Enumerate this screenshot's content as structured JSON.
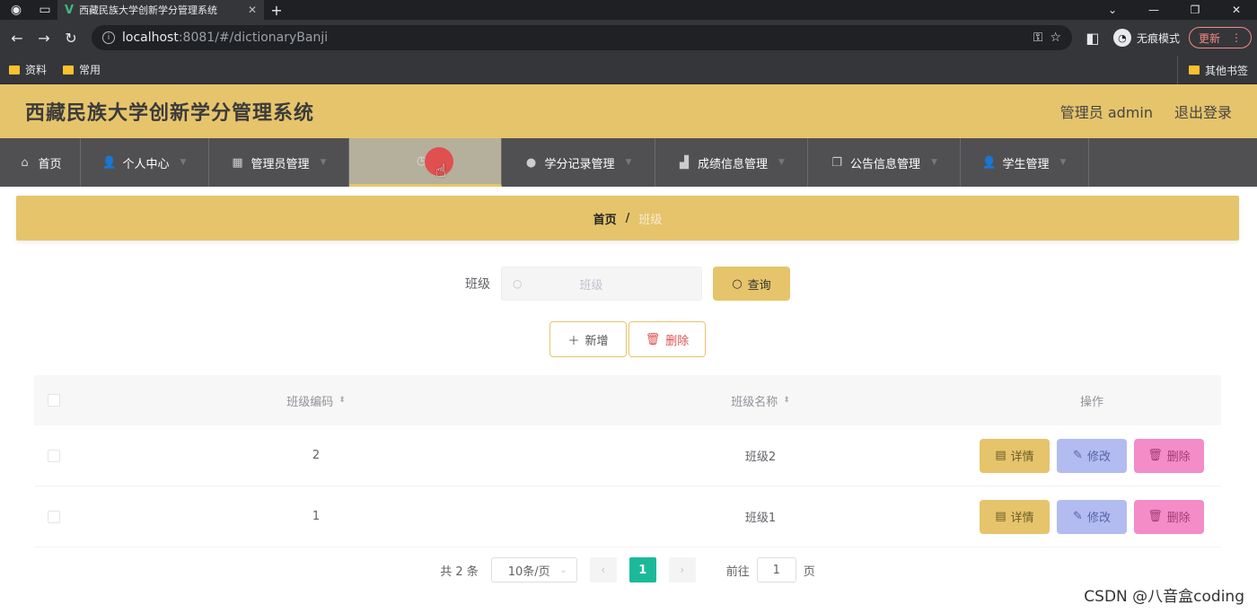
{
  "browser": {
    "tab_title": "西藏民族大学创新学分管理系统",
    "url_host": "localhost",
    "url_rest": ":8081/#/dictionaryBanji",
    "incognito_label": "无痕模式",
    "update_label": "更新",
    "bookmarks": [
      "资料",
      "常用"
    ],
    "other_bookmarks": "其他书签"
  },
  "header": {
    "title": "西藏民族大学创新学分管理系统",
    "user_label": "管理员 admin",
    "logout_label": "退出登录"
  },
  "menu": [
    {
      "label": "首页",
      "icon": "home-icon"
    },
    {
      "label": "个人中心",
      "icon": "user-icon"
    },
    {
      "label": "管理员管理",
      "icon": "grid-icon"
    },
    {
      "label": "",
      "icon": "clock-icon",
      "active": true
    },
    {
      "label": "学分记录管理",
      "icon": "pin-icon"
    },
    {
      "label": "成绩信息管理",
      "icon": "chart-icon"
    },
    {
      "label": "公告信息管理",
      "icon": "copy-icon"
    },
    {
      "label": "学生管理",
      "icon": "user-icon"
    }
  ],
  "breadcrumb": {
    "home": "首页",
    "separator": "/",
    "current": "班级"
  },
  "search": {
    "label": "班级",
    "placeholder": "班级",
    "query_button": "查询"
  },
  "actions": {
    "add_button": "新增",
    "delete_button": "删除"
  },
  "table": {
    "columns": [
      "班级编码",
      "班级名称",
      "操作"
    ],
    "rows": [
      {
        "code": "2",
        "name": "班级2"
      },
      {
        "code": "1",
        "name": "班级1"
      }
    ],
    "row_actions": {
      "detail": "详情",
      "edit": "修改",
      "delete": "删除"
    }
  },
  "pagination": {
    "total_text": "共 2 条",
    "page_size": "10条/页",
    "current_page": "1",
    "goto_label": "前往",
    "goto_value": "1",
    "page_suffix": "页"
  },
  "watermark": "CSDN @八音盒coding"
}
